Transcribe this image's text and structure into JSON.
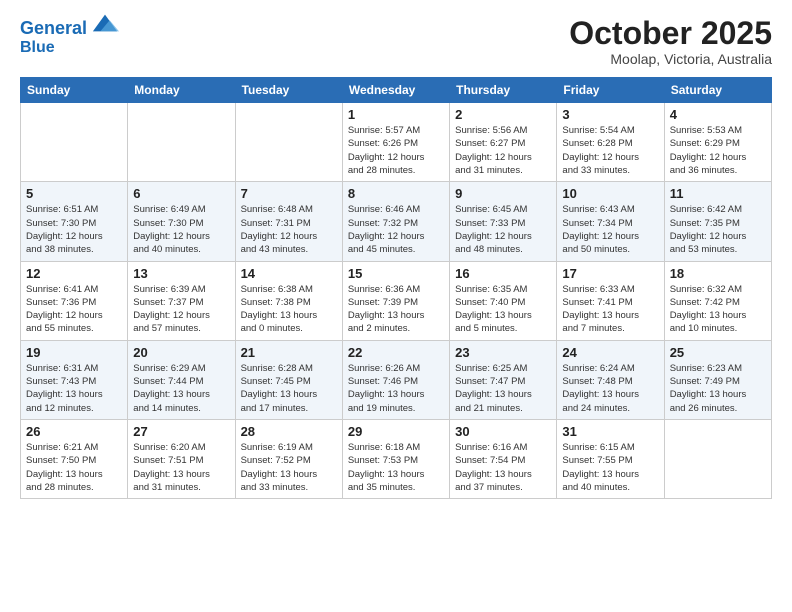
{
  "header": {
    "logo_line1": "General",
    "logo_line2": "Blue",
    "title": "October 2025",
    "location": "Moolap, Victoria, Australia"
  },
  "days_of_week": [
    "Sunday",
    "Monday",
    "Tuesday",
    "Wednesday",
    "Thursday",
    "Friday",
    "Saturday"
  ],
  "weeks": [
    [
      {
        "day": "",
        "info": ""
      },
      {
        "day": "",
        "info": ""
      },
      {
        "day": "",
        "info": ""
      },
      {
        "day": "1",
        "info": "Sunrise: 5:57 AM\nSunset: 6:26 PM\nDaylight: 12 hours\nand 28 minutes."
      },
      {
        "day": "2",
        "info": "Sunrise: 5:56 AM\nSunset: 6:27 PM\nDaylight: 12 hours\nand 31 minutes."
      },
      {
        "day": "3",
        "info": "Sunrise: 5:54 AM\nSunset: 6:28 PM\nDaylight: 12 hours\nand 33 minutes."
      },
      {
        "day": "4",
        "info": "Sunrise: 5:53 AM\nSunset: 6:29 PM\nDaylight: 12 hours\nand 36 minutes."
      }
    ],
    [
      {
        "day": "5",
        "info": "Sunrise: 6:51 AM\nSunset: 7:30 PM\nDaylight: 12 hours\nand 38 minutes."
      },
      {
        "day": "6",
        "info": "Sunrise: 6:49 AM\nSunset: 7:30 PM\nDaylight: 12 hours\nand 40 minutes."
      },
      {
        "day": "7",
        "info": "Sunrise: 6:48 AM\nSunset: 7:31 PM\nDaylight: 12 hours\nand 43 minutes."
      },
      {
        "day": "8",
        "info": "Sunrise: 6:46 AM\nSunset: 7:32 PM\nDaylight: 12 hours\nand 45 minutes."
      },
      {
        "day": "9",
        "info": "Sunrise: 6:45 AM\nSunset: 7:33 PM\nDaylight: 12 hours\nand 48 minutes."
      },
      {
        "day": "10",
        "info": "Sunrise: 6:43 AM\nSunset: 7:34 PM\nDaylight: 12 hours\nand 50 minutes."
      },
      {
        "day": "11",
        "info": "Sunrise: 6:42 AM\nSunset: 7:35 PM\nDaylight: 12 hours\nand 53 minutes."
      }
    ],
    [
      {
        "day": "12",
        "info": "Sunrise: 6:41 AM\nSunset: 7:36 PM\nDaylight: 12 hours\nand 55 minutes."
      },
      {
        "day": "13",
        "info": "Sunrise: 6:39 AM\nSunset: 7:37 PM\nDaylight: 12 hours\nand 57 minutes."
      },
      {
        "day": "14",
        "info": "Sunrise: 6:38 AM\nSunset: 7:38 PM\nDaylight: 13 hours\nand 0 minutes."
      },
      {
        "day": "15",
        "info": "Sunrise: 6:36 AM\nSunset: 7:39 PM\nDaylight: 13 hours\nand 2 minutes."
      },
      {
        "day": "16",
        "info": "Sunrise: 6:35 AM\nSunset: 7:40 PM\nDaylight: 13 hours\nand 5 minutes."
      },
      {
        "day": "17",
        "info": "Sunrise: 6:33 AM\nSunset: 7:41 PM\nDaylight: 13 hours\nand 7 minutes."
      },
      {
        "day": "18",
        "info": "Sunrise: 6:32 AM\nSunset: 7:42 PM\nDaylight: 13 hours\nand 10 minutes."
      }
    ],
    [
      {
        "day": "19",
        "info": "Sunrise: 6:31 AM\nSunset: 7:43 PM\nDaylight: 13 hours\nand 12 minutes."
      },
      {
        "day": "20",
        "info": "Sunrise: 6:29 AM\nSunset: 7:44 PM\nDaylight: 13 hours\nand 14 minutes."
      },
      {
        "day": "21",
        "info": "Sunrise: 6:28 AM\nSunset: 7:45 PM\nDaylight: 13 hours\nand 17 minutes."
      },
      {
        "day": "22",
        "info": "Sunrise: 6:26 AM\nSunset: 7:46 PM\nDaylight: 13 hours\nand 19 minutes."
      },
      {
        "day": "23",
        "info": "Sunrise: 6:25 AM\nSunset: 7:47 PM\nDaylight: 13 hours\nand 21 minutes."
      },
      {
        "day": "24",
        "info": "Sunrise: 6:24 AM\nSunset: 7:48 PM\nDaylight: 13 hours\nand 24 minutes."
      },
      {
        "day": "25",
        "info": "Sunrise: 6:23 AM\nSunset: 7:49 PM\nDaylight: 13 hours\nand 26 minutes."
      }
    ],
    [
      {
        "day": "26",
        "info": "Sunrise: 6:21 AM\nSunset: 7:50 PM\nDaylight: 13 hours\nand 28 minutes."
      },
      {
        "day": "27",
        "info": "Sunrise: 6:20 AM\nSunset: 7:51 PM\nDaylight: 13 hours\nand 31 minutes."
      },
      {
        "day": "28",
        "info": "Sunrise: 6:19 AM\nSunset: 7:52 PM\nDaylight: 13 hours\nand 33 minutes."
      },
      {
        "day": "29",
        "info": "Sunrise: 6:18 AM\nSunset: 7:53 PM\nDaylight: 13 hours\nand 35 minutes."
      },
      {
        "day": "30",
        "info": "Sunrise: 6:16 AM\nSunset: 7:54 PM\nDaylight: 13 hours\nand 37 minutes."
      },
      {
        "day": "31",
        "info": "Sunrise: 6:15 AM\nSunset: 7:55 PM\nDaylight: 13 hours\nand 40 minutes."
      },
      {
        "day": "",
        "info": ""
      }
    ]
  ]
}
